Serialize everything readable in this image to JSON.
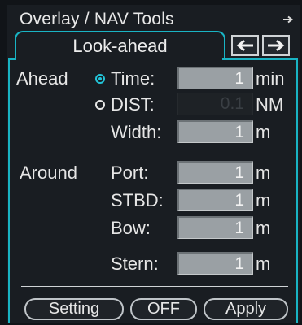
{
  "window": {
    "title": "Overlay / NAV Tools",
    "title_arrow_icon": "arrow-right-icon"
  },
  "tabs": {
    "active_label": "Look-ahead",
    "prev_icon": "arrow-left-icon",
    "next_icon": "arrow-right-icon"
  },
  "ahead": {
    "section_label": "Ahead",
    "time_label": "Time:",
    "time_value": "1",
    "time_unit": "min",
    "time_selected": true,
    "dist_label": "DIST:",
    "dist_value": "0.1",
    "dist_unit": "NM",
    "dist_selected": false,
    "width_label": "Width:",
    "width_value": "1",
    "width_unit": "m"
  },
  "around": {
    "section_label": "Around",
    "port_label": "Port:",
    "port_value": "1",
    "stbd_label": "STBD:",
    "stbd_value": "1",
    "bow_label": "Bow:",
    "bow_value": "1",
    "stern_label": "Stern:",
    "stern_value": "1",
    "unit": "m"
  },
  "footer": {
    "setting_label": "Setting",
    "off_label": "OFF",
    "apply_label": "Apply"
  },
  "colors": {
    "accent": "#19b4c4",
    "field": "#9aa0a4",
    "background": "#191d22"
  }
}
